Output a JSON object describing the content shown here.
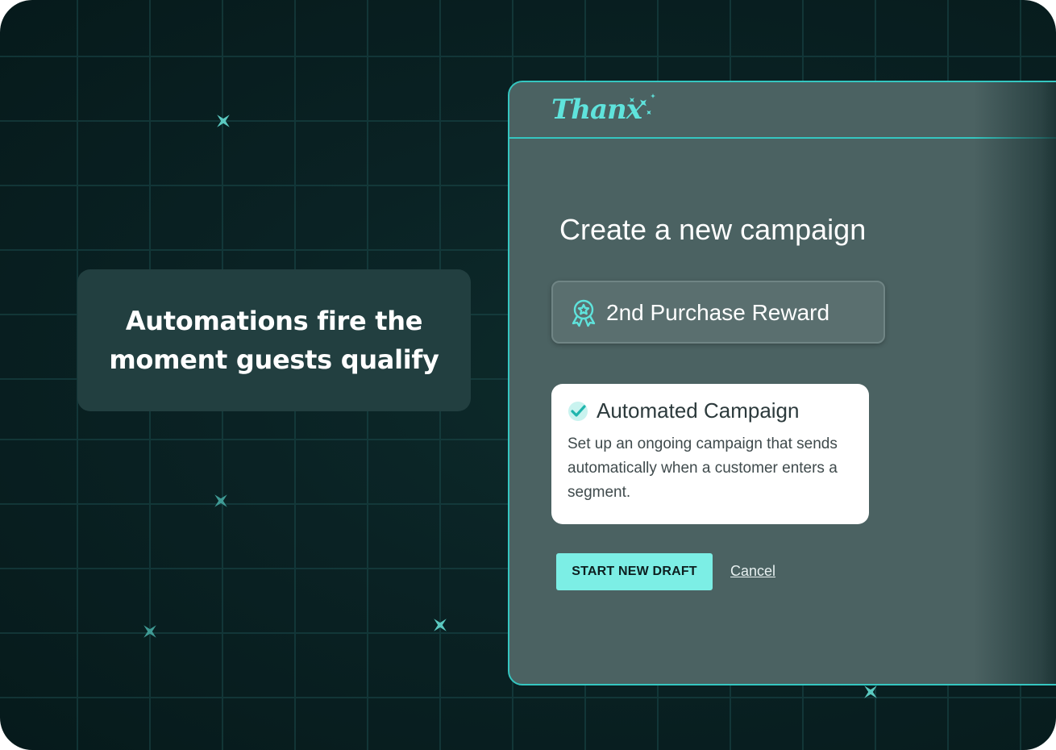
{
  "callout": {
    "text": "Automations fire the moment guests qualify"
  },
  "app": {
    "logo_text": "Thanx",
    "brand_color": "#5fe3dc",
    "accent_color": "#7ceee5",
    "border_color": "#35c6c0"
  },
  "dialog": {
    "title": "Create a new campaign",
    "campaign_name": "2nd Purchase Reward",
    "campaign_icon": "award-icon",
    "option": {
      "icon": "check-circle-icon",
      "title": "Automated Campaign",
      "description": "Set up an ongoing campaign that sends automatically when a customer enters a segment."
    },
    "primary_button": "START NEW DRAFT",
    "cancel_link": "Cancel"
  },
  "decor": {
    "sparkle_icon": "sparkle-icon"
  }
}
